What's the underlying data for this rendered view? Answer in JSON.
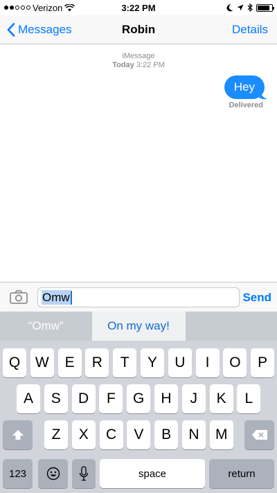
{
  "status": {
    "carrier": "Verizon",
    "signal_bars": 2,
    "signal_total": 5,
    "time": "3:22 PM",
    "battery_level": 0.85
  },
  "nav": {
    "back_label": "Messages",
    "title": "Robin",
    "details_label": "Details"
  },
  "conversation": {
    "service": "iMessage",
    "day": "Today",
    "time": "3:22 PM",
    "messages": [
      {
        "text": "Hey",
        "from": "me",
        "status": "Delivered"
      }
    ]
  },
  "compose": {
    "text": "Omw",
    "send_label": "Send"
  },
  "predictions": [
    "“Omw”",
    "On my way!",
    ""
  ],
  "keyboard": {
    "row1": [
      "Q",
      "W",
      "E",
      "R",
      "T",
      "Y",
      "U",
      "I",
      "O",
      "P"
    ],
    "row2": [
      "A",
      "S",
      "D",
      "F",
      "G",
      "H",
      "J",
      "K",
      "L"
    ],
    "row3": [
      "Z",
      "X",
      "C",
      "V",
      "B",
      "N",
      "M"
    ],
    "numbers_label": "123",
    "space_label": "space",
    "return_label": "return"
  },
  "colors": {
    "accent": "#007aff",
    "bubble": "#1a8cff",
    "keyboard_bg": "#d1d5db"
  }
}
